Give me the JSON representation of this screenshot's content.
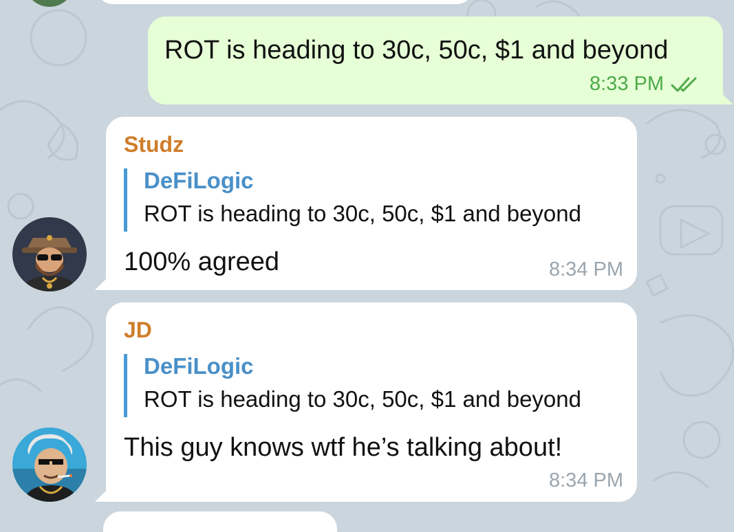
{
  "outgoing": {
    "text": "ROT is heading to 30c, 50c, $1 and beyond",
    "time": "8:33 PM",
    "status_icon": "double-check-read-icon",
    "bubble_color": "#e6ffd6",
    "meta_color": "#4daa49"
  },
  "messages": [
    {
      "sender": "Studz",
      "reply_to": {
        "name": "DeFiLogic",
        "text": "ROT is heading to 30c, 50c, $1 and beyond"
      },
      "text": "100% agreed",
      "time": "8:34 PM",
      "avatar_icon": "bearded-man-avatar-icon"
    },
    {
      "sender": "JD",
      "reply_to": {
        "name": "DeFiLogic",
        "text": "ROT is heading to 30c, 50c, $1 and beyond"
      },
      "text": "This guy knows wtf he’s talking about!",
      "time": "8:34 PM",
      "avatar_icon": "sunglasses-man-avatar-icon"
    }
  ],
  "colors": {
    "sender_name": "#cf7d2a",
    "reply_accent": "#4a9ad5",
    "background": "#cbd5dd"
  }
}
